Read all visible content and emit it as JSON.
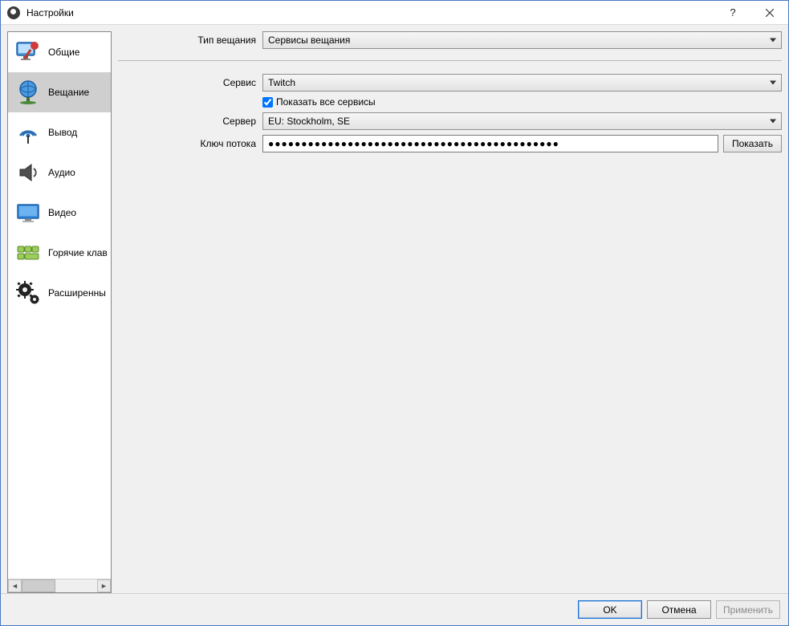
{
  "window": {
    "title": "Настройки"
  },
  "sidebar": {
    "items": [
      {
        "label": "Общие"
      },
      {
        "label": "Вещание"
      },
      {
        "label": "Вывод"
      },
      {
        "label": "Аудио"
      },
      {
        "label": "Видео"
      },
      {
        "label": "Горячие клав"
      },
      {
        "label": "Расширенны"
      }
    ],
    "selected_index": 1
  },
  "form": {
    "broadcast_type_label": "Тип вещания",
    "broadcast_type_value": "Сервисы вещания",
    "service_label": "Сервис",
    "service_value": "Twitch",
    "show_all_label": "Показать все сервисы",
    "show_all_checked": true,
    "server_label": "Сервер",
    "server_value": "EU: Stockholm, SE",
    "stream_key_label": "Ключ потока",
    "stream_key_mask": "●●●●●●●●●●●●●●●●●●●●●●●●●●●●●●●●●●●●●●●●●●●●",
    "show_key_button": "Показать"
  },
  "footer": {
    "ok": "OK",
    "cancel": "Отмена",
    "apply": "Применить"
  }
}
